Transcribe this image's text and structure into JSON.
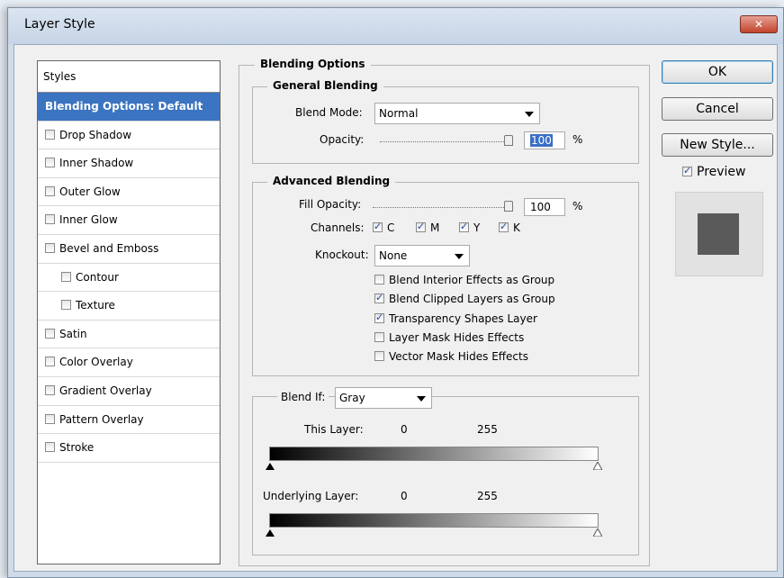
{
  "window": {
    "title": "Layer Style",
    "close_glyph": "✕"
  },
  "styles_panel": {
    "header": "Styles",
    "items": [
      {
        "label": "Blending Options: Default",
        "selected": true,
        "checkbox": false
      },
      {
        "label": "Drop Shadow",
        "checkbox": true,
        "checked": false
      },
      {
        "label": "Inner Shadow",
        "checkbox": true,
        "checked": false
      },
      {
        "label": "Outer Glow",
        "checkbox": true,
        "checked": false
      },
      {
        "label": "Inner Glow",
        "checkbox": true,
        "checked": false
      },
      {
        "label": "Bevel and Emboss",
        "checkbox": true,
        "checked": false
      },
      {
        "label": "Contour",
        "checkbox": true,
        "checked": false,
        "sub": true
      },
      {
        "label": "Texture",
        "checkbox": true,
        "checked": false,
        "sub": true
      },
      {
        "label": "Satin",
        "checkbox": true,
        "checked": false
      },
      {
        "label": "Color Overlay",
        "checkbox": true,
        "checked": false
      },
      {
        "label": "Gradient Overlay",
        "checkbox": true,
        "checked": false
      },
      {
        "label": "Pattern Overlay",
        "checkbox": true,
        "checked": false
      },
      {
        "label": "Stroke",
        "checkbox": true,
        "checked": false
      }
    ]
  },
  "blending_options": {
    "title": "Blending Options",
    "general": {
      "title": "General Blending",
      "blend_mode_label": "Blend Mode:",
      "blend_mode_value": "Normal",
      "opacity_label": "Opacity:",
      "opacity_value": "100",
      "opacity_unit": "%"
    },
    "advanced": {
      "title": "Advanced Blending",
      "fill_opacity_label": "Fill Opacity:",
      "fill_opacity_value": "100",
      "fill_opacity_unit": "%",
      "channels_label": "Channels:",
      "channels": [
        {
          "label": "C",
          "checked": true
        },
        {
          "label": "M",
          "checked": true
        },
        {
          "label": "Y",
          "checked": true
        },
        {
          "label": "K",
          "checked": true
        }
      ],
      "knockout_label": "Knockout:",
      "knockout_value": "None",
      "options": [
        {
          "label": "Blend Interior Effects as Group",
          "checked": false
        },
        {
          "label": "Blend Clipped Layers as Group",
          "checked": true
        },
        {
          "label": "Transparency Shapes Layer",
          "checked": true
        },
        {
          "label": "Layer Mask Hides Effects",
          "checked": false
        },
        {
          "label": "Vector Mask Hides Effects",
          "checked": false
        }
      ]
    },
    "blend_if": {
      "label": "Blend If:",
      "value": "Gray",
      "this_layer_label": "This Layer:",
      "this_layer_min": "0",
      "this_layer_max": "255",
      "underlying_label": "Underlying Layer:",
      "underlying_min": "0",
      "underlying_max": "255"
    }
  },
  "buttons": {
    "ok": "OK",
    "cancel": "Cancel",
    "new_style": "New Style...",
    "preview_label": "Preview",
    "preview_checked": true
  },
  "colors": {
    "selection": "#3b74c0",
    "preview_swatch": "#5a5a5a"
  }
}
